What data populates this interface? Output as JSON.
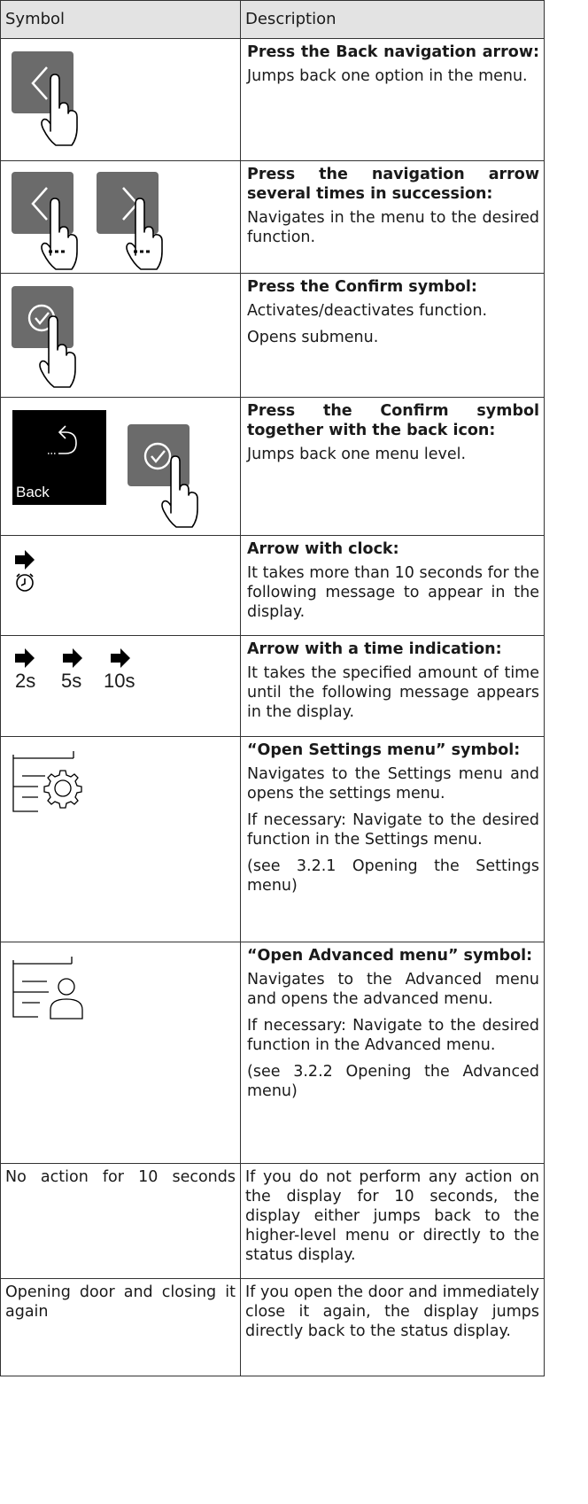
{
  "header": {
    "symbol": "Symbol",
    "description": "Description"
  },
  "rows": [
    {
      "title": "Press the Back navigation arrow:",
      "lines": [
        "Jumps back one option in the menu."
      ]
    },
    {
      "title": "Press the navigation arrow several times in succession:",
      "lines": [
        "Navigates in the menu to the desired function."
      ]
    },
    {
      "title": "Press the Confirm symbol:",
      "lines": [
        "Activates/deactivates function.",
        "Opens submenu."
      ]
    },
    {
      "title": "Press the Confirm symbol together with the back icon:",
      "lines": [
        "Jumps back one menu level."
      ],
      "back_label": "Back"
    },
    {
      "title": "Arrow with clock:",
      "lines": [
        "It takes more than 10 seconds for the following message to appear in the display."
      ]
    },
    {
      "title": "Arrow with a time indication:",
      "lines": [
        "It takes the specified amount of time until the following message appears in the display."
      ],
      "times": [
        "2s",
        "5s",
        "10s"
      ]
    },
    {
      "title": "“Open Settings menu” symbol:",
      "lines": [
        "Navigates to the Settings menu and opens the settings menu.",
        "If necessary: Navigate to the desired function in the Settings menu.",
        "(see 3.2.1 Opening the Settings menu)"
      ]
    },
    {
      "title": "“Open Advanced menu” symbol:",
      "lines": [
        "Navigates to the Advanced menu and opens the advanced menu.",
        "If necessary: Navigate to the desired function in the Advanced menu.",
        "(see 3.2.2 Opening the Advanced menu)"
      ]
    },
    {
      "left": "No action for 10 seconds",
      "right": "If you do not perform any action on the display for 10 seconds, the display either jumps back to the higher-level menu or directly to the status display."
    },
    {
      "left": "Opening door and closing it again",
      "right": "If you open the door and immedi­ately close it again, the display jumps directly back to the status display."
    }
  ],
  "colors": {
    "key": "#6b6b6b",
    "header": "#e3e3e3"
  }
}
